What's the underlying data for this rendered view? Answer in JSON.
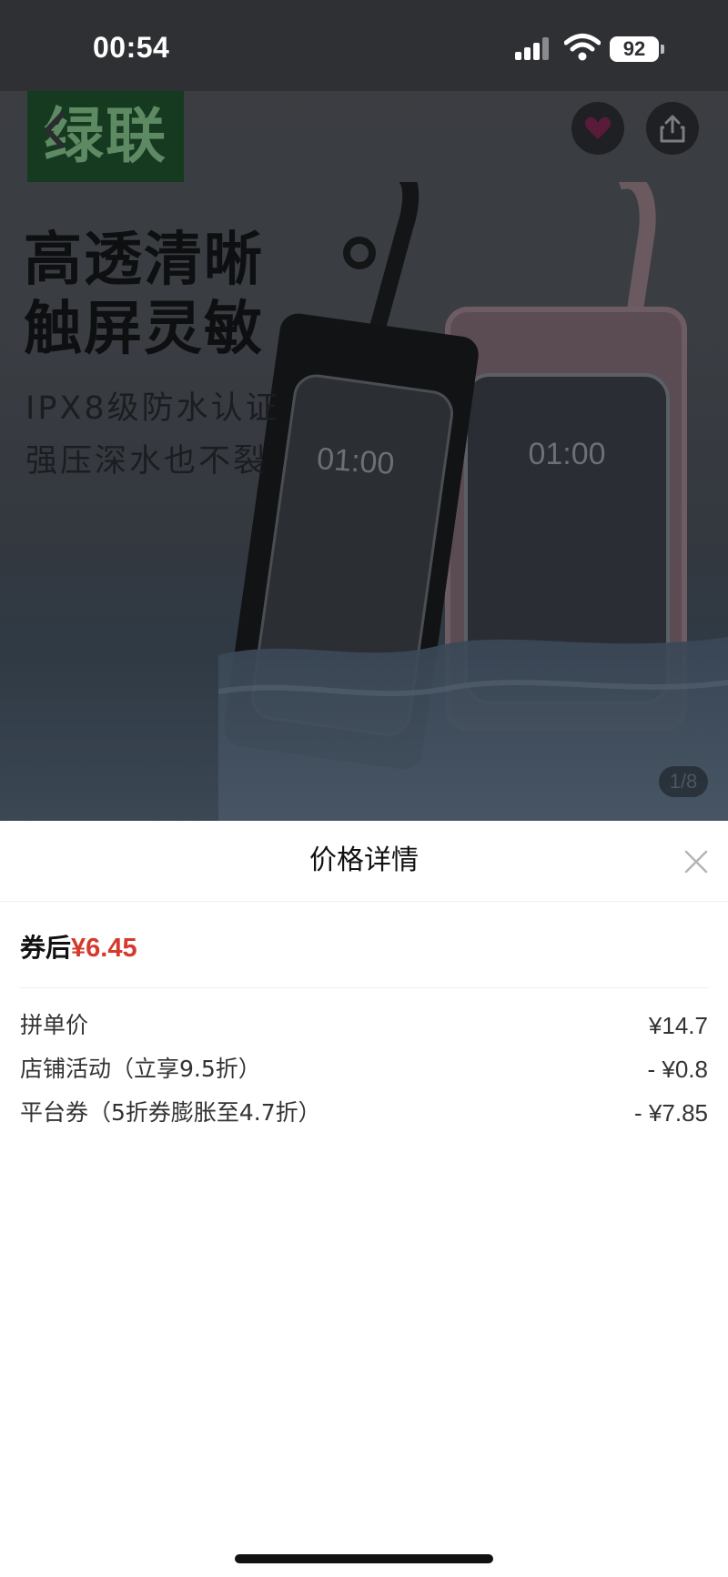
{
  "status_bar": {
    "time": "00:54",
    "battery": "92"
  },
  "product": {
    "brand_logo": "绿联",
    "headline_1": "高透清晰",
    "headline_2": "触屏灵敏",
    "subline_1": "IPX8级防水认证",
    "subline_2": "强压深水也不裂",
    "phone_clock_1": "01:00",
    "phone_clock_2": "01:00",
    "image_index": "1/8"
  },
  "sheet": {
    "title": "价格详情",
    "after_coupon_label": "券后",
    "after_coupon_price": "¥6.45",
    "rows": [
      {
        "label": "拼单价",
        "amount": "¥14.7"
      },
      {
        "label": "店铺活动（立享9.5折）",
        "amount": "- ¥0.8"
      },
      {
        "label": "平台券（5折券膨胀至4.7折）",
        "amount": "- ¥7.85"
      }
    ]
  },
  "colors": {
    "price_red": "#d43a2e",
    "overlay_dark": "#3a3d42",
    "logo_green": "#163a1f"
  }
}
